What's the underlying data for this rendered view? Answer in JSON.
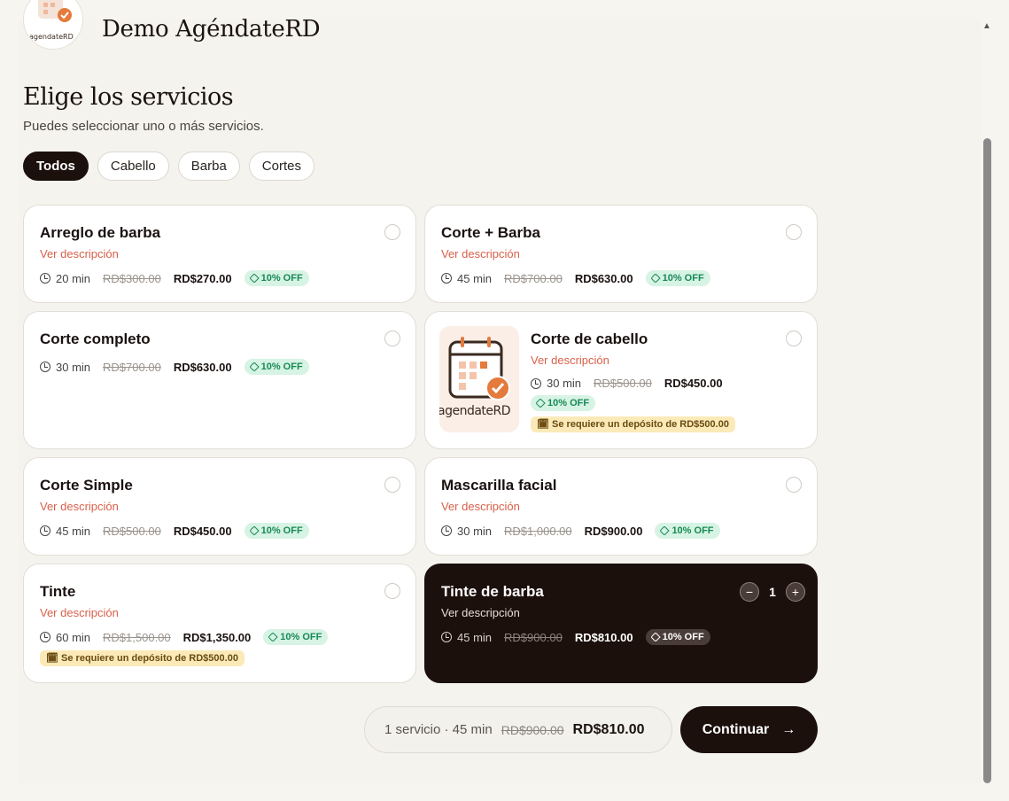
{
  "business": {
    "name": "Demo AgéndateRD",
    "logo_text": "agendateRD"
  },
  "heading": {
    "title": "Elige los servicios",
    "subtitle": "Puedes seleccionar uno o más servicios."
  },
  "filters": [
    {
      "label": "Todos",
      "active": true
    },
    {
      "label": "Cabello",
      "active": false
    },
    {
      "label": "Barba",
      "active": false
    },
    {
      "label": "Cortes",
      "active": false
    }
  ],
  "services": [
    {
      "name": "Arreglo de barba",
      "desc_link": "Ver descripción",
      "duration": "20 min",
      "old_price": "RD$300.00",
      "price": "RD$270.00",
      "discount": "10% OFF"
    },
    {
      "name": "Corte + Barba",
      "desc_link": "Ver descripción",
      "duration": "45 min",
      "old_price": "RD$700.00",
      "price": "RD$630.00",
      "discount": "10% OFF"
    },
    {
      "name": "Corte completo",
      "duration": "30 min",
      "old_price": "RD$700.00",
      "price": "RD$630.00",
      "discount": "10% OFF"
    },
    {
      "name": "Corte de cabello",
      "desc_link": "Ver descripción",
      "duration": "30 min",
      "old_price": "RD$500.00",
      "price": "RD$450.00",
      "discount": "10% OFF",
      "deposit": "Se requiere un depósito de RD$500.00",
      "thumb_text": "agendateRD"
    },
    {
      "name": "Corte Simple",
      "desc_link": "Ver descripción",
      "duration": "45 min",
      "old_price": "RD$500.00",
      "price": "RD$450.00",
      "discount": "10% OFF"
    },
    {
      "name": "Mascarilla facial",
      "desc_link": "Ver descripción",
      "duration": "30 min",
      "old_price": "RD$1,000.00",
      "price": "RD$900.00",
      "discount": "10% OFF"
    },
    {
      "name": "Tinte",
      "desc_link": "Ver descripción",
      "duration": "60 min",
      "old_price": "RD$1,500.00",
      "price": "RD$1,350.00",
      "discount": "10% OFF",
      "deposit": "Se requiere un depósito de RD$500.00"
    },
    {
      "name": "Tinte de barba",
      "desc_link": "Ver descripción",
      "duration": "45 min",
      "old_price": "RD$900.00",
      "price": "RD$810.00",
      "discount": "10% OFF",
      "selected": true,
      "quantity": "1"
    }
  ],
  "summary": {
    "info": "1 servicio · 45 min",
    "old_price": "RD$900.00",
    "price": "RD$810.00"
  },
  "continue_label": "Continuar",
  "icons": {
    "minus": "−",
    "plus": "+",
    "arrow": "→",
    "scroll_up": "▲"
  },
  "colors": {
    "dark": "#1c100c",
    "accent": "#d9604a",
    "discount_green": "#178a55",
    "deposit_yellow": "#fbeab8"
  }
}
